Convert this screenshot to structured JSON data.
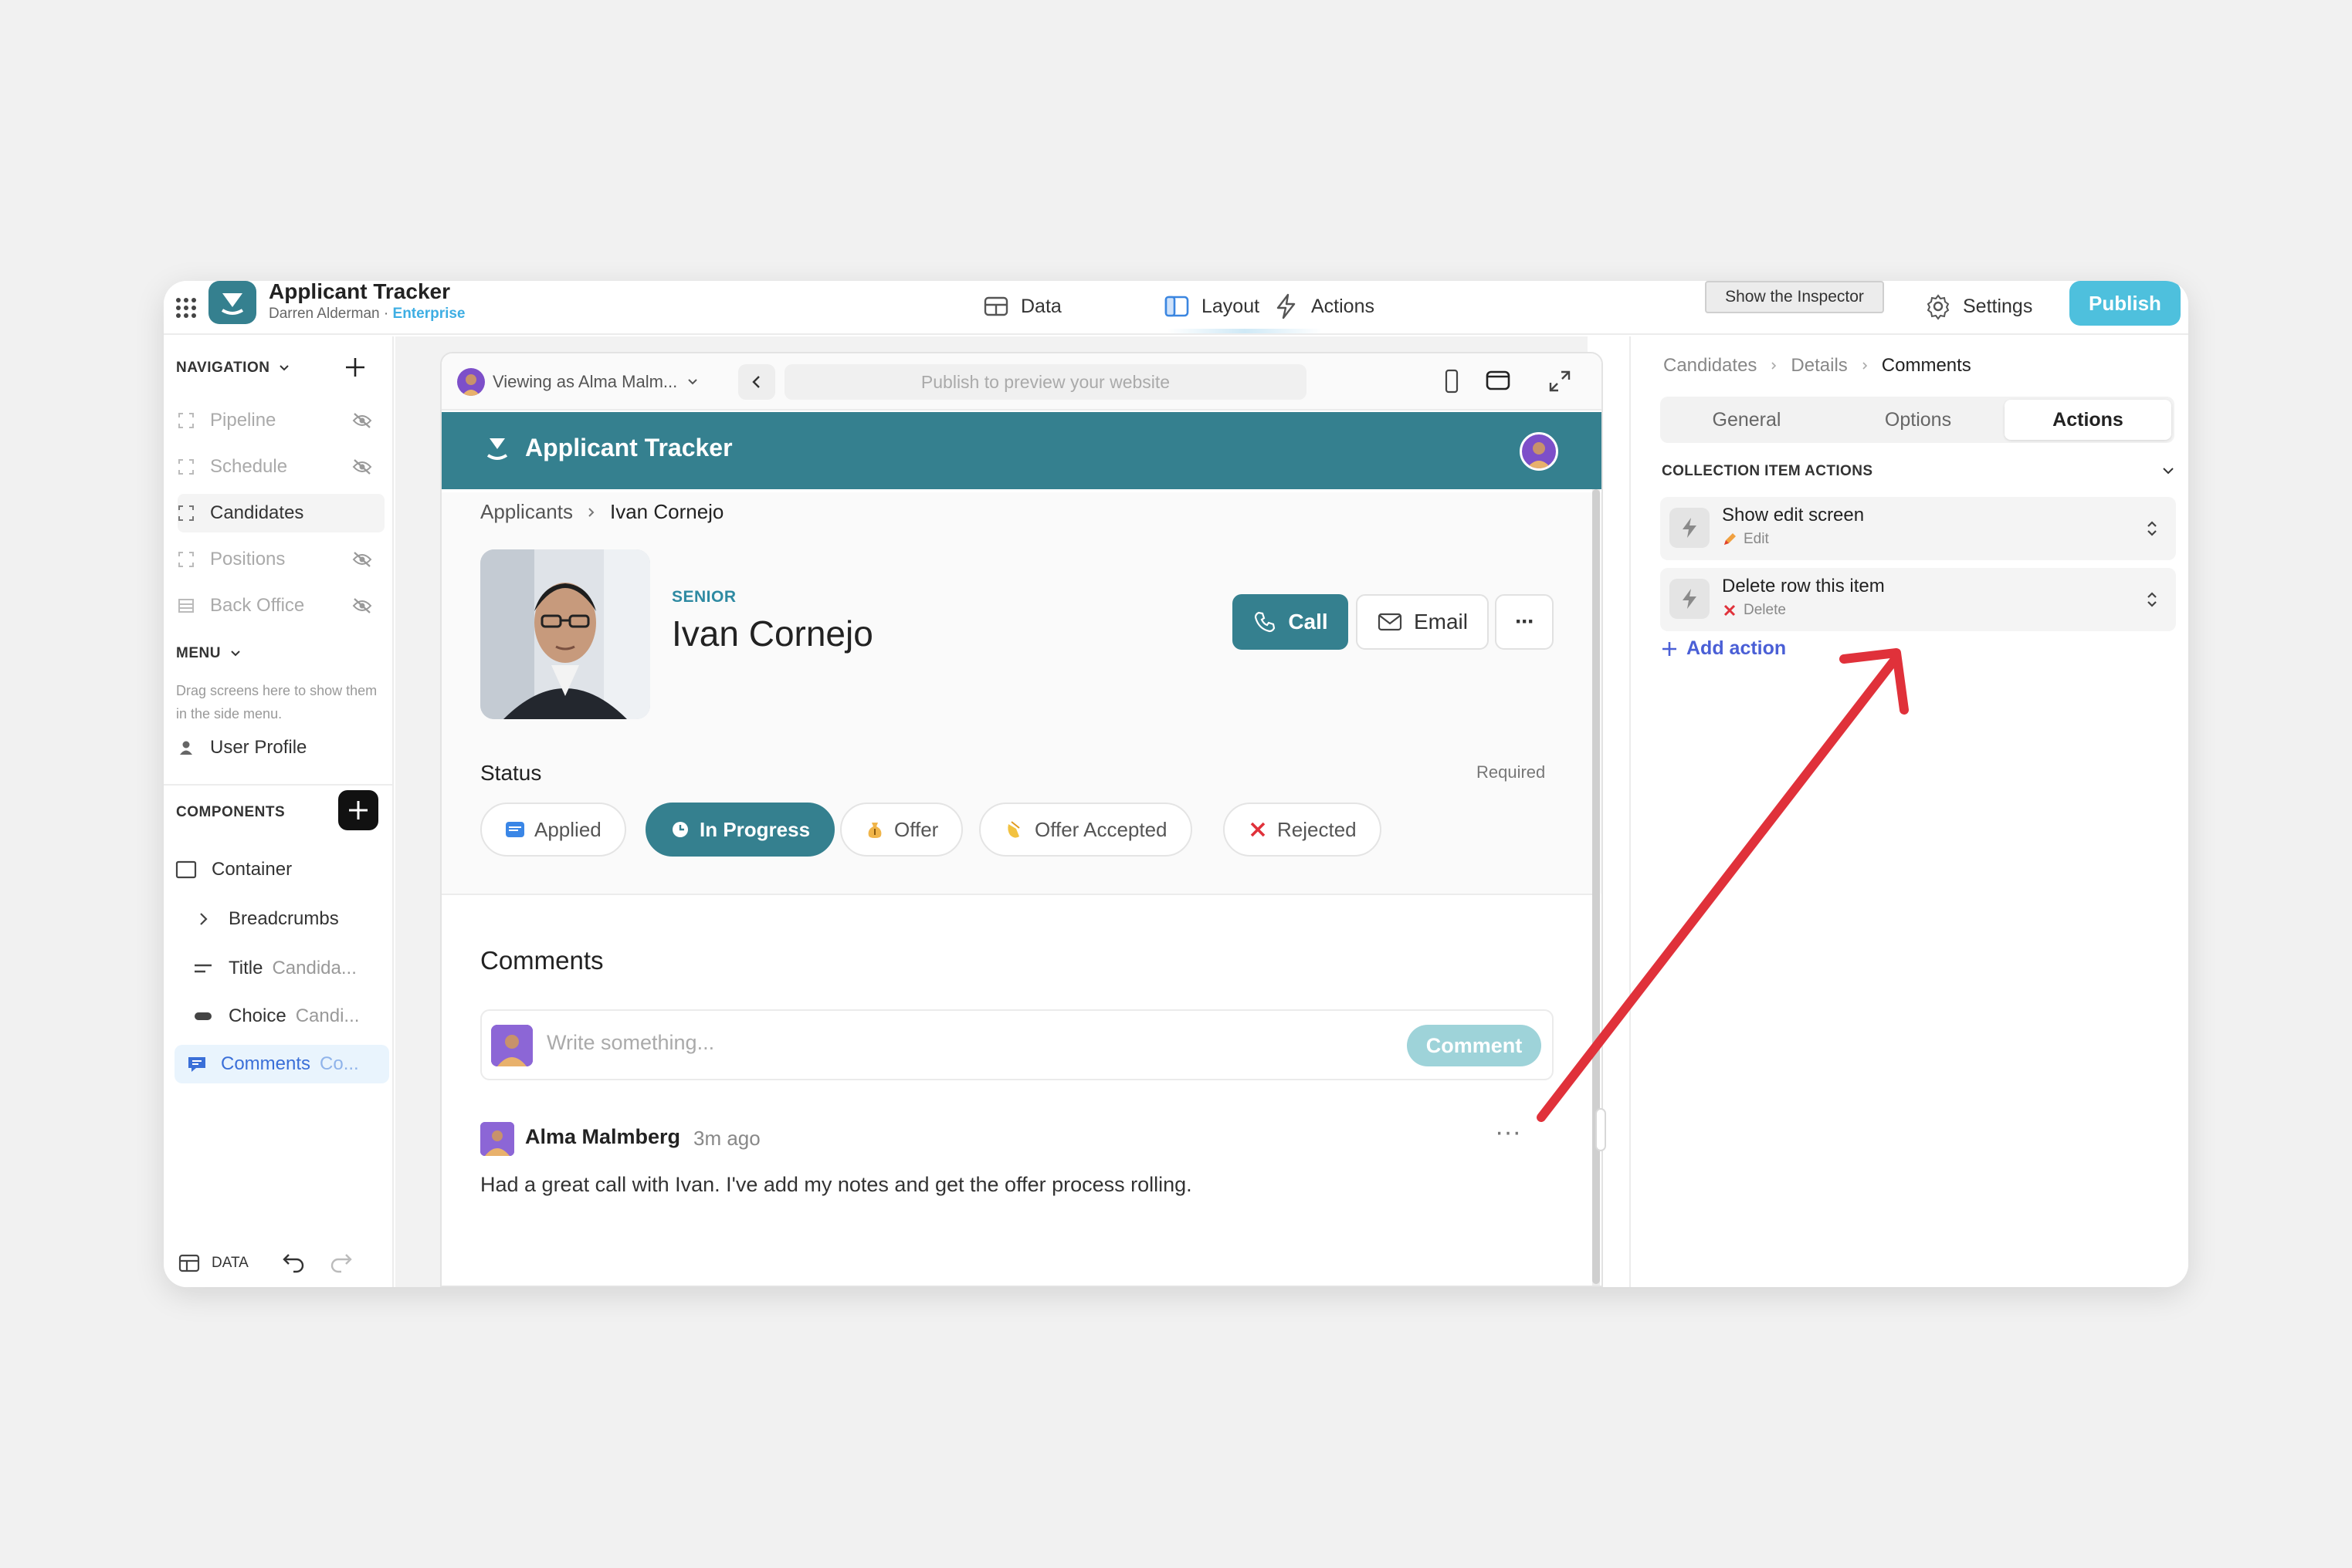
{
  "app": {
    "title": "Applicant Tracker",
    "owner": "Darren Alderman",
    "separator": "·",
    "plan": "Enterprise",
    "brand_color": "#35808f",
    "publish_color": "#4ec0dd"
  },
  "topnav": {
    "tabs": [
      {
        "label": "Data",
        "icon": "grid-table-icon"
      },
      {
        "label": "Layout",
        "icon": "layout-icon",
        "active": true
      },
      {
        "label": "Actions",
        "icon": "bolt-icon"
      }
    ],
    "inspector_tooltip": "Show the Inspector",
    "settings_label": "Settings",
    "publish_label": "Publish"
  },
  "sidebar": {
    "navigation_label": "NAVIGATION",
    "nav_items": [
      {
        "label": "Pipeline",
        "hidden": true
      },
      {
        "label": "Schedule",
        "hidden": true
      },
      {
        "label": "Candidates",
        "hidden": false,
        "selected": true
      },
      {
        "label": "Positions",
        "hidden": true
      },
      {
        "label": "Back Office",
        "hidden": true
      }
    ],
    "menu_label": "MENU",
    "menu_hint": "Drag screens here to show them in the side menu.",
    "menu_items": [
      {
        "label": "User Profile"
      }
    ],
    "components_label": "COMPONENTS",
    "components": [
      {
        "label": "Container",
        "sub": ""
      },
      {
        "label": "Breadcrumbs",
        "sub": ""
      },
      {
        "label": "Title",
        "sub": "Candida..."
      },
      {
        "label": "Choice",
        "sub": "Candi..."
      },
      {
        "label": "Comments",
        "sub": "Co...",
        "active": true
      }
    ],
    "footer_data_label": "DATA"
  },
  "preview": {
    "viewing_as": "Viewing as Alma Malm...",
    "url_placeholder": "Publish to preview your website",
    "header_title": "Applicant Tracker",
    "breadcrumb": [
      "Applicants",
      "Ivan Cornejo"
    ],
    "level": "SENIOR",
    "name": "Ivan Cornejo",
    "call_label": "Call",
    "email_label": "Email",
    "more_label": "···",
    "status_label": "Status",
    "required_label": "Required",
    "statuses": [
      {
        "label": "Applied",
        "icon": "new-badge-icon"
      },
      {
        "label": "In Progress",
        "icon": "clock-icon",
        "active": true
      },
      {
        "label": "Offer",
        "icon": "money-bag-icon"
      },
      {
        "label": "Offer Accepted",
        "icon": "clap-icon"
      },
      {
        "label": "Rejected",
        "icon": "x-mark-icon"
      }
    ],
    "comments_title": "Comments",
    "comment_placeholder": "Write something...",
    "comment_button": "Comment",
    "comment": {
      "author": "Alma Malmberg",
      "time": "3m ago",
      "text": "Had a great call with Ivan. I've add my notes and get the offer process rolling.",
      "more": "···"
    }
  },
  "inspector": {
    "breadcrumb": [
      "Candidates",
      "Details",
      "Comments"
    ],
    "tabs": [
      "General",
      "Options",
      "Actions"
    ],
    "active_tab": "Actions",
    "section_label": "COLLECTION ITEM ACTIONS",
    "actions": [
      {
        "title": "Show edit screen",
        "subtitle": "Edit",
        "icon": "pencil-icon"
      },
      {
        "title": "Delete row this item",
        "subtitle": "Delete",
        "icon": "x-mark-icon"
      }
    ],
    "add_action_label": "Add action",
    "help_label": "?"
  },
  "annotation": {
    "arrow_color": "#e0313a"
  }
}
